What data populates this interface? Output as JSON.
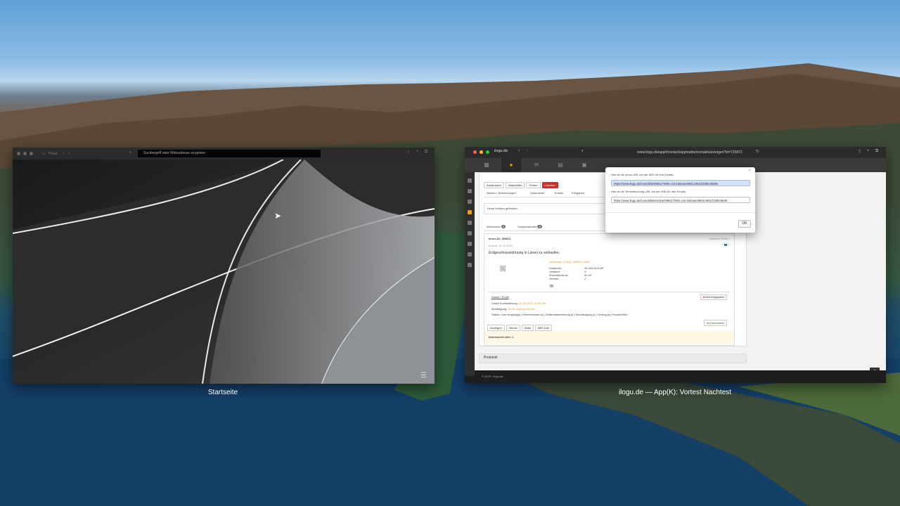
{
  "desktop": {
    "window1_label": "Startseite",
    "window2_label": "ilogu.de — App(K): Vortest Nachtest"
  },
  "safari_left": {
    "tab_title": "Privat",
    "url_placeholder": "Suchbegriff oder Webadresse eingeben"
  },
  "safari_right": {
    "tab_title": "ilogu.de",
    "url": "www.ilogu.de/app/#contact/appmatteckontaktsanzeigen?id=725872",
    "toolbar": {
      "print": "Ausdrucken",
      "edit": "Bearbeiten",
      "appointment": "Termin",
      "delete": "Löschen"
    },
    "tabs": [
      "Notizen / Bemerkungen",
      "Dokumente",
      "Emails",
      "Freigaben"
    ],
    "notes_empty": "Keine Notizen gefunden...",
    "subtabs": {
      "interested": "Interessiert",
      "interested_count": "1",
      "search_params": "Suchparameter",
      "search_params_count": "0"
    },
    "immo": {
      "id": "Immo-ID: 360811",
      "created": "erstellt: 18.04.2022",
      "agent": "<Markus Prüfer>",
      "headline": "Erdgeschosswohnung in Lünen zu verkaufen.",
      "address": "Wiesenstr. 4 (EG), 44532 Lünen",
      "rows": [
        {
          "k": "Kaufpreis:",
          "v": "40.000,00 EUR"
        },
        {
          "k": "Verkauft:",
          "v": "✔"
        },
        {
          "k": "Wohnfläche ca.:",
          "v": "52 m²"
        },
        {
          "k": "Zimmer:",
          "v": "2"
        }
      ],
      "share": "nicht freigegeben",
      "contact_name": "Daniel / Email",
      "last_contact_label": "Letzte Kontaktierung:",
      "last_contact": "20.03.2023 11:08 Uhr",
      "confirmed_label": "Bestätigung:",
      "confirmed": "20.03.2023 11:10 Uhr",
      "status_label": "Status:",
      "status": "vom eingeloggt | Gewerbschein ja | Widerrufsbelehrung ja | Beauftragung ja | Vertrag ja | Provisionfrei -",
      "actions": [
        "Anzeigen",
        "Termin",
        "Notiz",
        "IMO-Link"
      ],
      "interest_btn": "Ist Interessiert",
      "interested_footer": "Interessiert sich: 1"
    },
    "protokoll": "Protokoll",
    "footer": "© 2023 - ilogu.de"
  },
  "dialog": {
    "line1": "Hier ist die Immo-URL mit der WID für Ihre Emails:",
    "url1": "https://www.ilogu.de/immobilie/868117WID=e2c1844aee9641c952cf2af5c69d8e",
    "line2": "Hier ist die Terminbuchung-URL mit der WID für Ihre Emails:",
    "url2": "https://www.ilogu.de/immobilie/termine/868117WID=e2c1844aee9641c952cf2af5c69d8",
    "ok": "OK"
  }
}
